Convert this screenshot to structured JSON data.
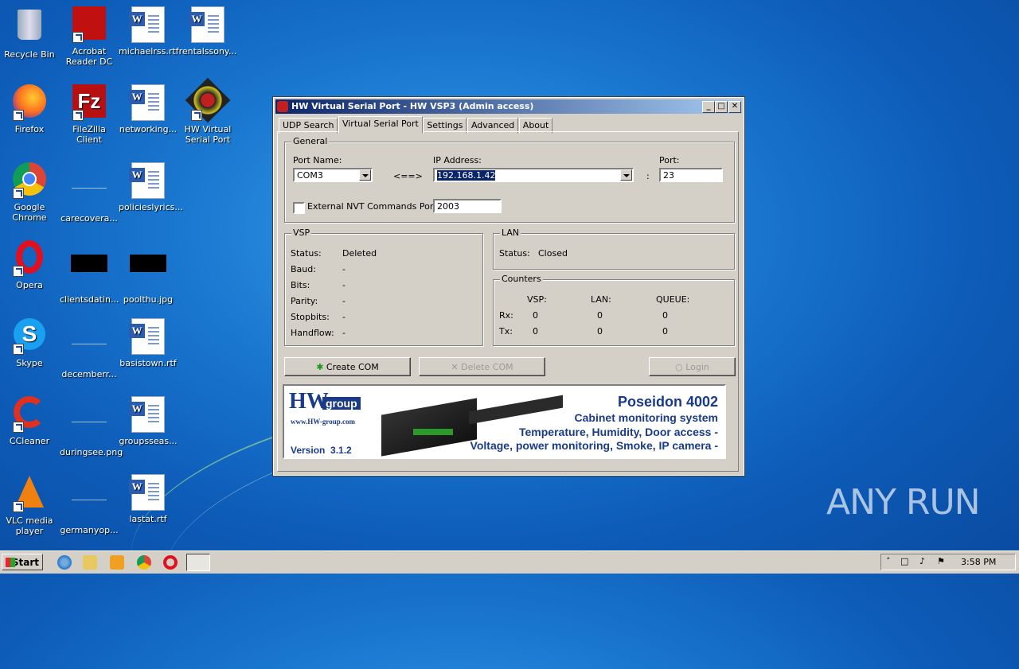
{
  "desktop": {
    "icons": [
      {
        "label": "Recycle Bin"
      },
      {
        "label": "Acrobat Reader DC"
      },
      {
        "label": "michaelrss.rtf"
      },
      {
        "label": "rentalssony..."
      },
      {
        "label": "Firefox"
      },
      {
        "label": "FileZilla Client"
      },
      {
        "label": "networking..."
      },
      {
        "label": "HW Virtual Serial Port"
      },
      {
        "label": "Google Chrome"
      },
      {
        "label": "carecovera..."
      },
      {
        "label": "policieslyrics..."
      },
      {
        "label": "Opera"
      },
      {
        "label": "clientsdatin..."
      },
      {
        "label": "poolthu.jpg"
      },
      {
        "label": "Skype"
      },
      {
        "label": "decemberr..."
      },
      {
        "label": "basistown.rtf"
      },
      {
        "label": "CCleaner"
      },
      {
        "label": "duringsee.png"
      },
      {
        "label": "groupsseas..."
      },
      {
        "label": "VLC media player"
      },
      {
        "label": "germanyop..."
      },
      {
        "label": "lastat.rtf"
      }
    ]
  },
  "window": {
    "title": "HW Virtual Serial Port - HW VSP3 (Admin access)",
    "tabs": [
      "UDP Search",
      "Virtual Serial Port",
      "Settings",
      "Advanced",
      "About"
    ],
    "general": {
      "title": "General",
      "port_name_label": "Port Name:",
      "port_name_value": "COM3",
      "arrow": "<==>",
      "ip_label": "IP Address:",
      "ip_value": "192.168.1.42",
      "colon": ":",
      "port_label": "Port:",
      "port_value": "23",
      "nvt_label": "External NVT Commands Port:",
      "nvt_value": "2003"
    },
    "vsp": {
      "title": "VSP",
      "rows": [
        {
          "k": "Status:",
          "v": "Deleted"
        },
        {
          "k": "Baud:",
          "v": "-"
        },
        {
          "k": "Bits:",
          "v": "-"
        },
        {
          "k": "Parity:",
          "v": "-"
        },
        {
          "k": "Stopbits:",
          "v": "-"
        },
        {
          "k": "Handflow:",
          "v": "-"
        }
      ]
    },
    "lan": {
      "title": "LAN",
      "status_label": "Status:",
      "status_value": "Closed"
    },
    "counters": {
      "title": "Counters",
      "headers": [
        "VSP:",
        "LAN:",
        "QUEUE:"
      ],
      "rx_label": "Rx:",
      "rx": [
        "0",
        "0",
        "0"
      ],
      "tx_label": "Tx:",
      "tx": [
        "0",
        "0",
        "0"
      ]
    },
    "buttons": {
      "create": "Create COM",
      "delete": "Delete COM",
      "login": "Login"
    },
    "banner": {
      "logo_main": "HW",
      "logo_group": "group",
      "logo_url": "www.HW-group.com",
      "version": "Version  3.1.2",
      "product": "Poseidon 4002",
      "line1": "Cabinet monitoring system",
      "line2": "Temperature, Humidity, Door access -",
      "line3": "Voltage, power monitoring, Smoke, IP camera -"
    }
  },
  "taskbar": {
    "start": "Start",
    "clock": "3:58 PM"
  },
  "watermark": "ANY  RUN"
}
